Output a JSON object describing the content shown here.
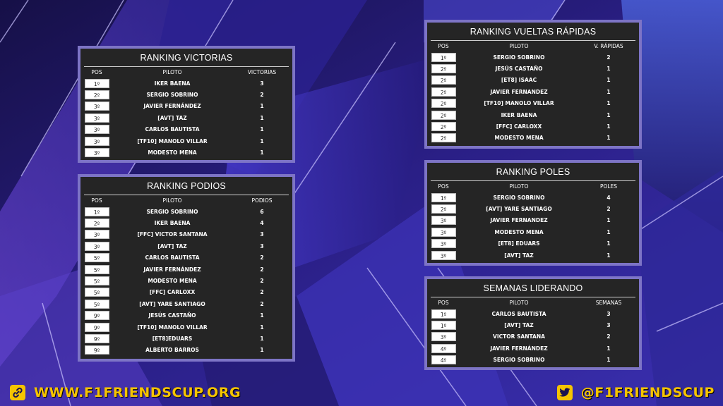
{
  "colors": {
    "panel_border": "#7d74c6",
    "panel_bg": "#252525",
    "accent": "#f5c400"
  },
  "victorias": {
    "title": "RANKING VICTORIAS",
    "headers": [
      "POS",
      "PILOTO",
      "VICTORIAS"
    ],
    "rows": [
      [
        "1º",
        "IKER BAENA",
        "3"
      ],
      [
        "2º",
        "SERGIO SOBRINO",
        "2"
      ],
      [
        "3º",
        "JAVIER FERNÁNDEZ",
        "1"
      ],
      [
        "3º",
        "[AVT] TAZ",
        "1"
      ],
      [
        "3º",
        "CARLOS BAUTISTA",
        "1"
      ],
      [
        "3º",
        "[TF10] MANOLO VILLAR",
        "1"
      ],
      [
        "3º",
        "MODESTO MENA",
        "1"
      ]
    ]
  },
  "podios": {
    "title": "RANKING PODIOS",
    "headers": [
      "POS",
      "PILOTO",
      "PODIOS"
    ],
    "rows": [
      [
        "1º",
        "SERGIO SOBRINO",
        "6"
      ],
      [
        "2º",
        "IKER BAENA",
        "4"
      ],
      [
        "3º",
        "[FFC] VICTOR SANTANA",
        "3"
      ],
      [
        "3º",
        "[AVT] TAZ",
        "3"
      ],
      [
        "5º",
        "CARLOS BAUTISTA",
        "2"
      ],
      [
        "5º",
        "JAVIER FERNÁNDEZ",
        "2"
      ],
      [
        "5º",
        "MODESTO MENA",
        "2"
      ],
      [
        "5º",
        "[FFC] CARLOXX",
        "2"
      ],
      [
        "5º",
        "[AVT] YARE SANTIAGO",
        "2"
      ],
      [
        "9º",
        "JESÚS CASTAÑO",
        "1"
      ],
      [
        "9º",
        "[TF10] MANOLO VILLAR",
        "1"
      ],
      [
        "9º",
        "[ET8]EDUARS",
        "1"
      ],
      [
        "9º",
        "ALBERTO BARROS",
        "1"
      ]
    ]
  },
  "vueltas": {
    "title": "RANKING VUELTAS RÁPIDAS",
    "headers": [
      "POS",
      "PILOTO",
      "V. RÁPIDAS"
    ],
    "rows": [
      [
        "1º",
        "SERGIO SOBRINO",
        "2"
      ],
      [
        "2º",
        "JESÚS CASTAÑO",
        "1"
      ],
      [
        "2º",
        "[ET8] ISAAC",
        "1"
      ],
      [
        "2º",
        "JAVIER FERNANDEZ",
        "1"
      ],
      [
        "2º",
        "[TF10] MANOLO VILLAR",
        "1"
      ],
      [
        "2º",
        "IKER BAENA",
        "1"
      ],
      [
        "2º",
        "[FFC] CARLOXX",
        "1"
      ],
      [
        "2º",
        "MODESTO MENA",
        "1"
      ]
    ]
  },
  "poles": {
    "title": "RANKING POLES",
    "headers": [
      "POS",
      "PILOTO",
      "POLES"
    ],
    "rows": [
      [
        "1º",
        "SERGIO SOBRINO",
        "4"
      ],
      [
        "2º",
        "[AVT] YARE SANTIAGO",
        "2"
      ],
      [
        "3º",
        "JAVIER FERNANDEZ",
        "1"
      ],
      [
        "3º",
        "MODESTO MENA",
        "1"
      ],
      [
        "3º",
        "[ET8] EDUARS",
        "1"
      ],
      [
        "3º",
        "[AVT] TAZ",
        "1"
      ]
    ]
  },
  "semanas": {
    "title": "SEMANAS LIDERANDO",
    "headers": [
      "POS",
      "PILOTO",
      "SEMANAS"
    ],
    "rows": [
      [
        "1º",
        "CARLOS BAUTISTA",
        "3"
      ],
      [
        "1º",
        "[AVT] TAZ",
        "3"
      ],
      [
        "3º",
        "VICTOR SANTANA",
        "2"
      ],
      [
        "4º",
        "JAVIER FERNÁNDEZ",
        "1"
      ],
      [
        "4º",
        "SERGIO SOBRINO",
        "1"
      ]
    ]
  },
  "footer": {
    "website": "WWW.F1FRIENDSCUP.ORG",
    "website_icon": "link-icon",
    "twitter": "@F1FRIENDSCUP",
    "twitter_icon": "twitter-bird-icon"
  }
}
